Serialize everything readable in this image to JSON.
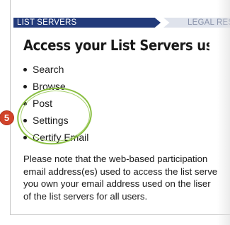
{
  "tabs": {
    "active": "LIST SERVERS",
    "next": "LEGAL RESO"
  },
  "heading": "Access your List Servers using the",
  "options": [
    {
      "label": "Search"
    },
    {
      "label": "Browse"
    },
    {
      "label": "Post"
    },
    {
      "label": "Settings"
    },
    {
      "label": "Certify Email"
    }
  ],
  "note_lines": [
    "Please note that the web-based participation",
    "email address(es) used to access the list serve",
    "you own your email address used on the liser",
    "of the list servers for all users."
  ],
  "callout": {
    "step": "5",
    "ring_color": "#88be3f",
    "badge_color": "#d1432a"
  },
  "colors": {
    "tab_active": "#223a7a",
    "tab_next": "#dfe3ec"
  }
}
